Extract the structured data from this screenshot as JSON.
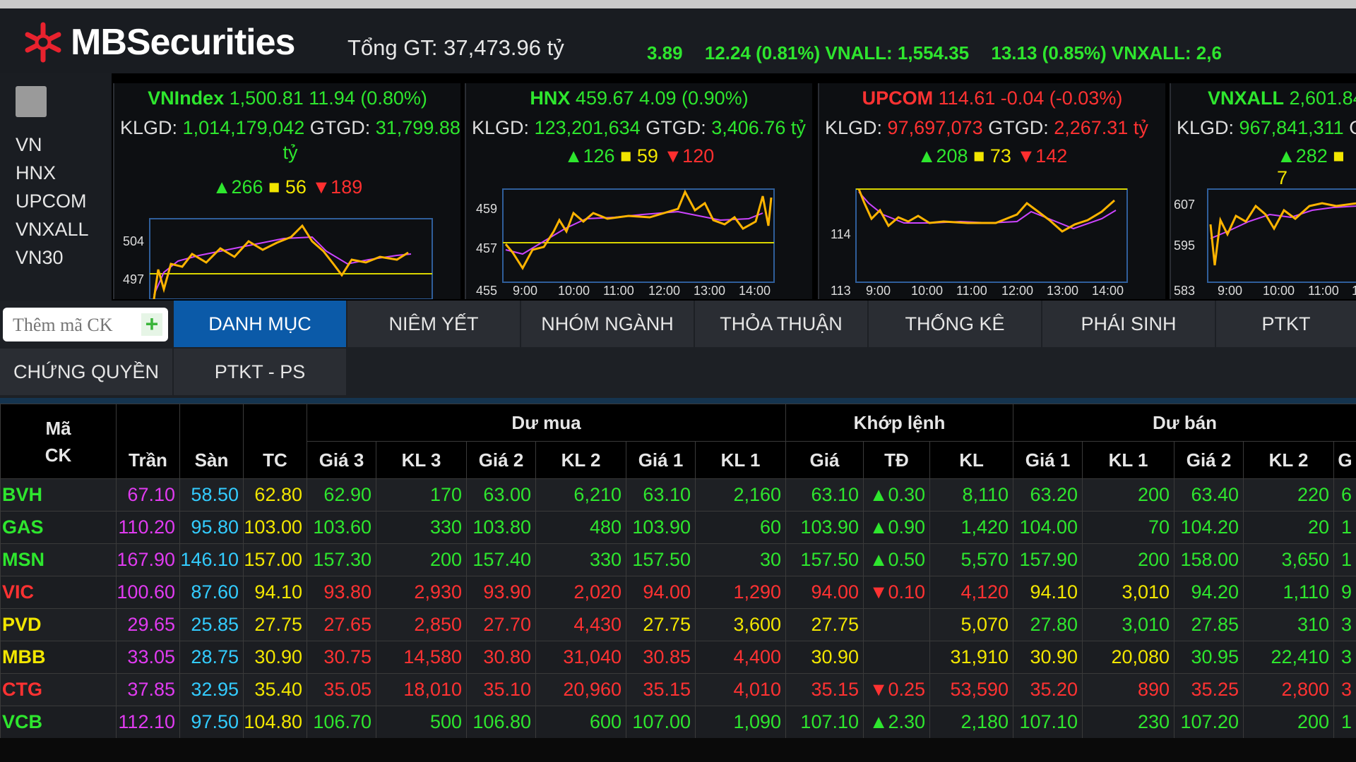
{
  "header": {
    "logo_text": "MBSecurities",
    "total_value": "Tổng GT: 37,473.96 tỷ",
    "ticker": [
      {
        "name": "",
        "text": "3.89"
      },
      {
        "name": "",
        "text": "12.24 (0.81%) VNALL: 1,554.35"
      },
      {
        "name": "",
        "text": "13.13 (0.85%) VNXALL: 2,6"
      }
    ]
  },
  "leftnav": {
    "items": [
      "VN",
      "HNX",
      "UPCOM",
      "VNXALL",
      "VN30"
    ]
  },
  "panels": [
    {
      "name": "VNIndex",
      "value": "1,500.81 11.94 (0.80%)",
      "color": "#2ee62e",
      "klgd_label": "KLGD:",
      "klgd": "1,014,179,042",
      "gtgd_label": "GTGD:",
      "gtgd": "31,799.88",
      "unit": "tỷ",
      "advances": "266",
      "unchanged": "56",
      "declines": "189",
      "y_labels": [
        "504",
        "497"
      ],
      "x_labels": []
    },
    {
      "name": "HNX",
      "value": "459.67 4.09 (0.90%)",
      "color": "#2ee62e",
      "klgd_label": "KLGD:",
      "klgd": "123,201,634",
      "gtgd_label": "GTGD:",
      "gtgd": "3,406.76 tỷ",
      "advances": "126",
      "unchanged": "59",
      "declines": "120",
      "y_labels": [
        "459",
        "457",
        "455"
      ],
      "x_labels": [
        "9:00",
        "10:00",
        "11:00",
        "12:00",
        "13:00",
        "14:00"
      ]
    },
    {
      "name": "UPCOM",
      "value": "114.61 -0.04 (-0.03%)",
      "color": "#ff3232",
      "klgd_label": "KLGD:",
      "klgd": "97,697,073",
      "gtgd_label": "GTGD:",
      "gtgd": "2,267.31 tỷ",
      "advances": "208",
      "unchanged": "73",
      "declines": "142",
      "y_labels": [
        "114",
        "113"
      ],
      "x_labels": [
        "9:00",
        "10:00",
        "11:00",
        "12:00",
        "13:00",
        "14:00"
      ]
    },
    {
      "name": "VNXALL",
      "value": "2,601.84",
      "color": "#2ee62e",
      "klgd_label": "KLGD:",
      "klgd": "967,841,311",
      "gtgd_label": "G",
      "advances": "282",
      "unchanged": "7",
      "y_labels": [
        "607",
        "595",
        "583"
      ],
      "x_labels": [
        "9:00",
        "10:00",
        "11:00",
        "1"
      ]
    }
  ],
  "search": {
    "placeholder": "Thêm mã CK",
    "add": "+"
  },
  "tabs": [
    {
      "label": "DANH MỤC",
      "active": true
    },
    {
      "label": "NIÊM YẾT"
    },
    {
      "label": "NHÓM NGÀNH"
    },
    {
      "label": "THỎA THUẬN"
    },
    {
      "label": "THỐNG KÊ"
    },
    {
      "label": "PHÁI SINH"
    },
    {
      "label": "PTKT"
    },
    {
      "label": "CHỨNG QUYỀN"
    },
    {
      "label": "PTKT - PS"
    }
  ],
  "table": {
    "group_headers": [
      "Dư mua",
      "Khớp lệnh",
      "Dư bán"
    ],
    "headers": [
      "Mã CK",
      "Trần",
      "Sàn",
      "TC",
      "Giá 3",
      "KL 3",
      "Giá 2",
      "KL 2",
      "Giá 1",
      "KL 1",
      "Giá",
      "TĐ",
      "KL",
      "Giá 1",
      "KL 1",
      "Giá 2",
      "KL 2",
      "G"
    ],
    "rows": [
      {
        "c": [
          "BVH",
          "67.10",
          "58.50",
          "62.80",
          "62.90",
          "170",
          "63.00",
          "6,210",
          "63.10",
          "2,160",
          "63.10",
          "▲0.30",
          "8,110",
          "63.20",
          "200",
          "63.40",
          "220",
          "6"
        ],
        "k": [
          "g",
          "p",
          "c",
          "y",
          "g",
          "g",
          "g",
          "g",
          "g",
          "g",
          "g",
          "g",
          "g",
          "g",
          "g",
          "g",
          "g",
          "g"
        ]
      },
      {
        "c": [
          "GAS",
          "110.20",
          "95.80",
          "103.00",
          "103.60",
          "330",
          "103.80",
          "480",
          "103.90",
          "60",
          "103.90",
          "▲0.90",
          "1,420",
          "104.00",
          "70",
          "104.20",
          "20",
          "1"
        ],
        "k": [
          "g",
          "p",
          "c",
          "y",
          "g",
          "g",
          "g",
          "g",
          "g",
          "g",
          "g",
          "g",
          "g",
          "g",
          "g",
          "g",
          "g",
          "g"
        ]
      },
      {
        "c": [
          "MSN",
          "167.90",
          "146.10",
          "157.00",
          "157.30",
          "200",
          "157.40",
          "330",
          "157.50",
          "30",
          "157.50",
          "▲0.50",
          "5,570",
          "157.90",
          "200",
          "158.00",
          "3,650",
          "1"
        ],
        "k": [
          "g",
          "p",
          "c",
          "y",
          "g",
          "g",
          "g",
          "g",
          "g",
          "g",
          "g",
          "g",
          "g",
          "g",
          "g",
          "g",
          "g",
          "g"
        ]
      },
      {
        "c": [
          "VIC",
          "100.60",
          "87.60",
          "94.10",
          "93.80",
          "2,930",
          "93.90",
          "2,020",
          "94.00",
          "1,290",
          "94.00",
          "▼0.10",
          "4,120",
          "94.10",
          "3,010",
          "94.20",
          "1,110",
          "9"
        ],
        "k": [
          "r",
          "p",
          "c",
          "y",
          "r",
          "r",
          "r",
          "r",
          "r",
          "r",
          "r",
          "r",
          "r",
          "y",
          "y",
          "g",
          "g",
          "g"
        ]
      },
      {
        "c": [
          "PVD",
          "29.65",
          "25.85",
          "27.75",
          "27.65",
          "2,850",
          "27.70",
          "4,430",
          "27.75",
          "3,600",
          "27.75",
          "",
          "5,070",
          "27.80",
          "3,010",
          "27.85",
          "310",
          "3"
        ],
        "k": [
          "y",
          "p",
          "c",
          "y",
          "r",
          "r",
          "r",
          "r",
          "y",
          "y",
          "y",
          "y",
          "y",
          "g",
          "g",
          "g",
          "g",
          "g"
        ]
      },
      {
        "c": [
          "MBB",
          "33.05",
          "28.75",
          "30.90",
          "30.75",
          "14,580",
          "30.80",
          "31,040",
          "30.85",
          "4,400",
          "30.90",
          "",
          "31,910",
          "30.90",
          "20,080",
          "30.95",
          "22,410",
          "3"
        ],
        "k": [
          "y",
          "p",
          "c",
          "y",
          "r",
          "r",
          "r",
          "r",
          "r",
          "r",
          "y",
          "y",
          "y",
          "y",
          "y",
          "g",
          "g",
          "g"
        ]
      },
      {
        "c": [
          "CTG",
          "37.85",
          "32.95",
          "35.40",
          "35.05",
          "18,010",
          "35.10",
          "20,960",
          "35.15",
          "4,010",
          "35.15",
          "▼0.25",
          "53,590",
          "35.20",
          "890",
          "35.25",
          "2,800",
          "3"
        ],
        "k": [
          "r",
          "p",
          "c",
          "y",
          "r",
          "r",
          "r",
          "r",
          "r",
          "r",
          "r",
          "r",
          "r",
          "r",
          "r",
          "r",
          "r",
          "r"
        ]
      },
      {
        "c": [
          "VCB",
          "112.10",
          "97.50",
          "104.80",
          "106.70",
          "500",
          "106.80",
          "600",
          "107.00",
          "1,090",
          "107.10",
          "▲2.30",
          "2,180",
          "107.10",
          "230",
          "107.20",
          "200",
          "1"
        ],
        "k": [
          "g",
          "p",
          "c",
          "y",
          "g",
          "g",
          "g",
          "g",
          "g",
          "g",
          "g",
          "g",
          "g",
          "g",
          "g",
          "g",
          "g",
          "g"
        ]
      }
    ]
  },
  "colors": {
    "green": "#2ee62e",
    "red": "#ff3232",
    "yellow": "#f2e600",
    "purple": "#e03bf0",
    "cyan": "#33ccff",
    "active_tab": "#0b5aa8"
  }
}
